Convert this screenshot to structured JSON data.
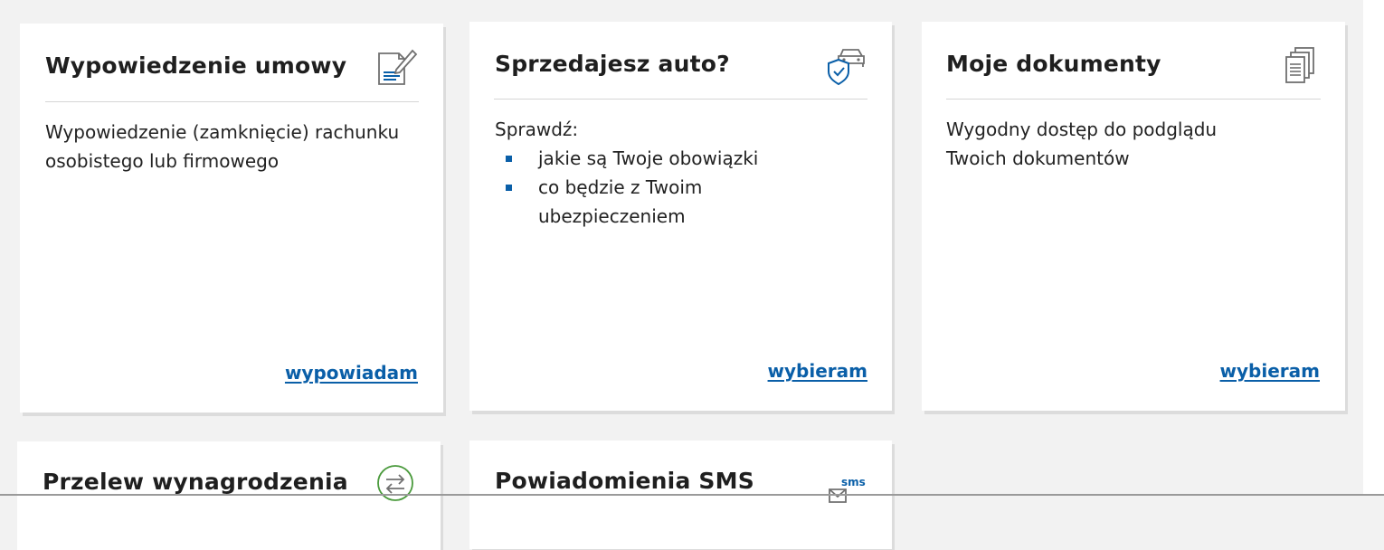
{
  "cards": [
    {
      "title": "Wypowiedzenie umowy",
      "icon": "document-sign-icon",
      "description": "Wypowiedzenie (zamknięcie) rachunku osobistego lub firmowego",
      "link": "wypowiadam"
    },
    {
      "title": "Sprzedajesz auto?",
      "icon": "car-shield-icon",
      "intro": "Sprawdź:",
      "bullets": [
        "jakie są Twoje obowiązki",
        "co będzie z Twoim ubezpieczeniem"
      ],
      "link": "wybieram"
    },
    {
      "title": "Moje dokumenty",
      "icon": "documents-stack-icon",
      "description": "Wygodny dostęp do podglądu Twoich dokumentów",
      "link": "wybieram"
    },
    {
      "title": "Przelew wynagrodzenia",
      "icon": "transfer-arrows-icon"
    },
    {
      "title": "Powiadomienia SMS",
      "icon": "sms-envelope-icon",
      "icon_text": "sms"
    }
  ],
  "colors": {
    "page_background": "#f2f2f2",
    "card_background": "#ffffff",
    "accent": "#0a5fa8",
    "icon_gray": "#707070"
  }
}
